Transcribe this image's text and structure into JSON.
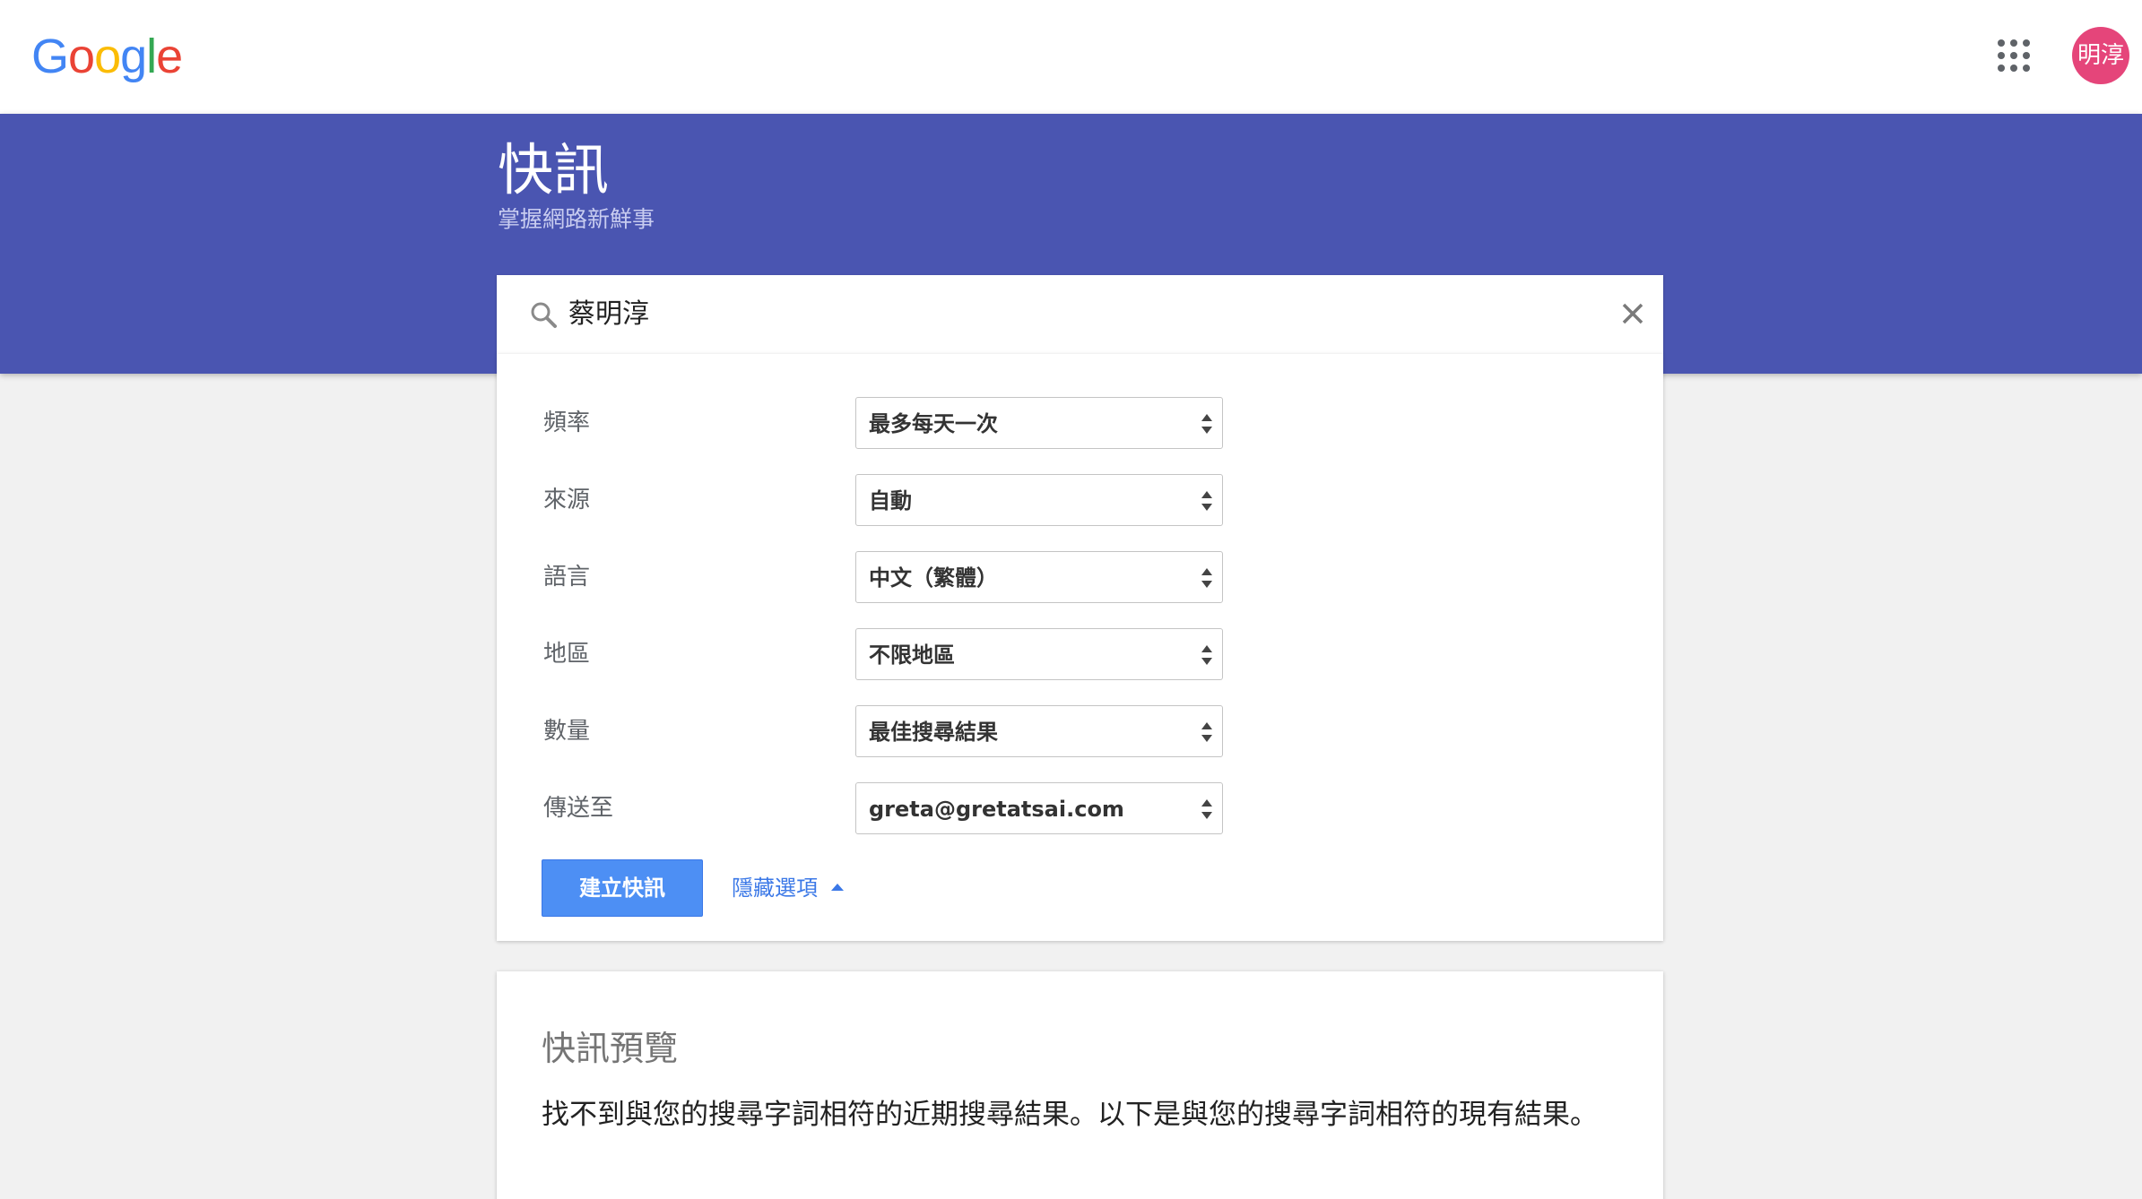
{
  "header": {
    "logo_letters": [
      {
        "ch": "G",
        "color": "#4285F4"
      },
      {
        "ch": "o",
        "color": "#EA4335"
      },
      {
        "ch": "o",
        "color": "#FBBC05"
      },
      {
        "ch": "g",
        "color": "#4285F4"
      },
      {
        "ch": "l",
        "color": "#34A853"
      },
      {
        "ch": "e",
        "color": "#EA4335"
      }
    ],
    "apps_icon": "apps-grid-icon",
    "avatar_text": "明淳",
    "avatar_color": "#e5457a"
  },
  "banner": {
    "title": "快訊",
    "subtitle": "掌握網路新鮮事",
    "color": "#4a55b1"
  },
  "search": {
    "value": "蔡明淳",
    "search_icon": "search-icon",
    "clear_icon": "close-icon"
  },
  "options": {
    "rows": [
      {
        "label": "頻率",
        "value": "最多每天一次"
      },
      {
        "label": "來源",
        "value": "自動"
      },
      {
        "label": "語言",
        "value": "中文（繁體）"
      },
      {
        "label": "地區",
        "value": "不限地區"
      },
      {
        "label": "數量",
        "value": "最佳搜尋結果"
      },
      {
        "label": "傳送至",
        "value": "greta@gretatsai.com"
      }
    ],
    "create_button": "建立快訊",
    "hide_options": "隱藏選項"
  },
  "preview": {
    "title": "快訊預覽",
    "message": "找不到與您的搜尋字詞相符的近期搜尋結果。以下是與您的搜尋字詞相符的現有結果。"
  }
}
